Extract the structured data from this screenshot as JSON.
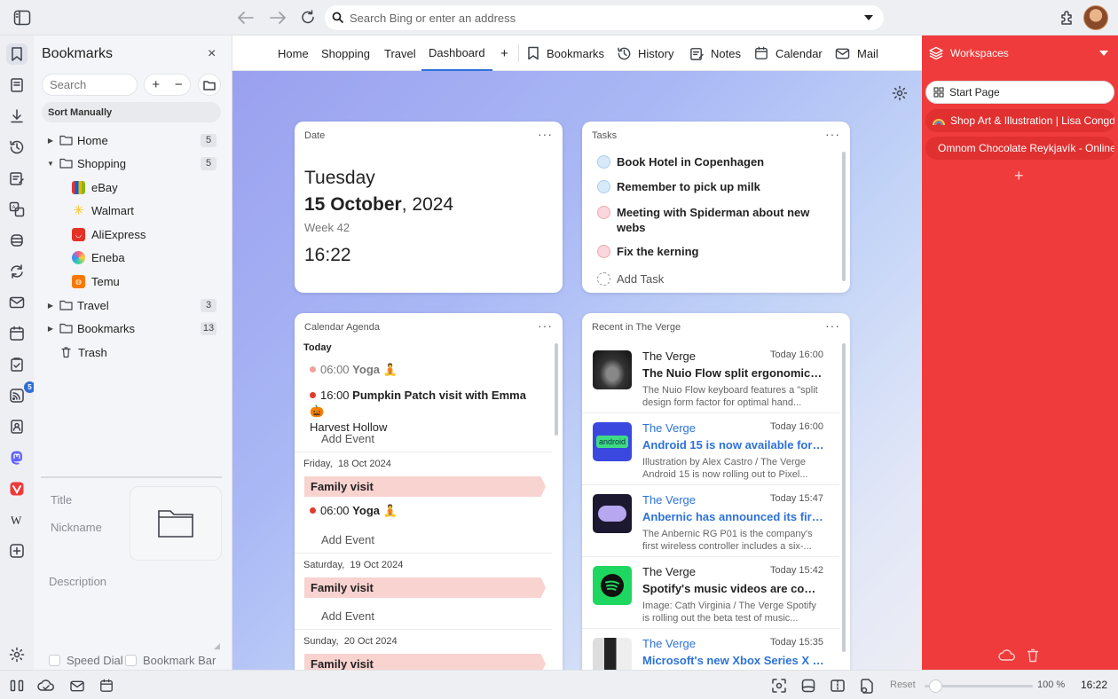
{
  "toolbar": {
    "address_placeholder": "Search Bing or enter an address"
  },
  "bookmarks_panel": {
    "title": "Bookmarks",
    "close": "×",
    "search_placeholder": "Search",
    "add": "+",
    "remove": "−",
    "sort_label": "Sort Manually",
    "tree": [
      {
        "label": "Home",
        "count": "5"
      },
      {
        "label": "Shopping",
        "count": "5"
      },
      {
        "label": "eBay"
      },
      {
        "label": "Walmart"
      },
      {
        "label": "AliExpress"
      },
      {
        "label": "Eneba"
      },
      {
        "label": "Temu"
      },
      {
        "label": "Travel",
        "count": "3"
      },
      {
        "label": "Bookmarks",
        "count": "13"
      },
      {
        "label": "Trash"
      }
    ],
    "fields": {
      "title": "Title",
      "nickname": "Nickname",
      "description": "Description"
    },
    "speed_dial": "Speed Dial",
    "bookmark_bar": "Bookmark Bar"
  },
  "rail": {
    "feed_badge": "5"
  },
  "tabs": {
    "items": [
      "Home",
      "Shopping",
      "Travel",
      "Dashboard"
    ],
    "active": "Dashboard",
    "plus": "+",
    "panels": [
      "Bookmarks",
      "History",
      "Notes",
      "Calendar",
      "Mail"
    ]
  },
  "dashboard": {
    "date_card": {
      "header": "Date",
      "weekday": "Tuesday",
      "date_bold": "15 October",
      "year": ", 2024",
      "week": "Week 42",
      "time": "16:22"
    },
    "tasks_card": {
      "header": "Tasks",
      "tasks": [
        {
          "text": "Book Hotel in Copenhagen",
          "color": "#d8eaf8"
        },
        {
          "text": "Remember to pick up milk",
          "color": "#d8eaf8"
        },
        {
          "text": "Meeting with Spiderman about new webs",
          "color": "#f9d7dc"
        },
        {
          "text": "Fix the kerning",
          "color": "#f9d7dc"
        }
      ],
      "add_task": "Add Task"
    },
    "agenda_card": {
      "header": "Calendar Agenda",
      "today": "Today",
      "today_events": [
        {
          "time": "06:00",
          "title": "Yoga",
          "emoji": "🧘"
        },
        {
          "time": "16:00",
          "title": "Pumpkin Patch visit with Emma",
          "emoji": "🎃",
          "location": "Harvest Hollow"
        }
      ],
      "add_event": "Add Event",
      "days": [
        {
          "label": "Friday,",
          "date": "18 Oct 2024",
          "banner": "Family visit",
          "event_time": "06:00",
          "event_title": "Yoga",
          "event_emoji": "🧘"
        },
        {
          "label": "Saturday,",
          "date": "19 Oct 2024",
          "banner": "Family visit"
        },
        {
          "label": "Sunday,",
          "date": "20 Oct 2024",
          "banner": "Family visit"
        }
      ]
    },
    "news_card": {
      "header": "Recent in The Verge",
      "items": [
        {
          "source": "The Verge",
          "time": "Today 16:00",
          "headline": "The Nuio Flow split ergonomic ke...",
          "summary": "The Nuio Flow keyboard features a \"split design form factor for optimal hand...",
          "unread": false
        },
        {
          "source": "The Verge",
          "time": "Today 16:00",
          "headline": "Android 15 is now available for Pi...",
          "summary": "Illustration by Alex Castro / The Verge Android 15 is now rolling out to Pixel...",
          "unread": true,
          "thumb_text": "android"
        },
        {
          "source": "The Verge",
          "time": "Today 15:47",
          "headline": "Anbernic has announced its first ...",
          "summary": "The Anbernic RG P01 is the company's first wireless controller includes a six-...",
          "unread": true
        },
        {
          "source": "The Verge",
          "time": "Today 15:42",
          "headline": "Spotify's music videos are comin...",
          "summary": "Image: Cath Virginia / The Verge Spotify is rolling out the beta test of music...",
          "unread": false
        },
        {
          "source": "The Verge",
          "time": "Today 15:35",
          "headline": "Microsoft's new Xbox Series X m...",
          "summary": "",
          "unread": true
        }
      ]
    }
  },
  "workspaces": {
    "title": "Workspaces",
    "items": [
      {
        "label": "Start Page"
      },
      {
        "label": "Shop Art & Illustration | Lisa Congdon"
      },
      {
        "label": "Omnom Chocolate Reykjavík - Online"
      }
    ],
    "add": "+"
  },
  "statusbar": {
    "reset": "Reset",
    "zoom": "100 %",
    "zoom_level": 0.1,
    "clock": "16:22"
  },
  "colors": {
    "accent": "#2d72d9",
    "workspace_bg": "#ef3b3b"
  }
}
